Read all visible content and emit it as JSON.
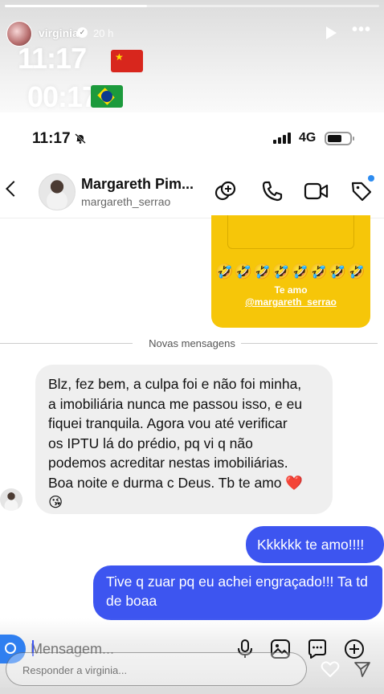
{
  "story": {
    "username": "virginia",
    "time_ago": "20 h",
    "times": [
      "11:17",
      "00:17"
    ],
    "flags": [
      "china-flag",
      "brazil-flag"
    ],
    "progress": 0.38,
    "reply_placeholder": "Responder a virginia..."
  },
  "status_bar": {
    "time": "11:17",
    "network": "4G"
  },
  "chat_header": {
    "name": "Margareth Pim...",
    "username": "margareth_serrao"
  },
  "story_reply": {
    "emojis": "🤣🤣🤣🤣🤣🤣🤣🤣",
    "text": "Te amo",
    "mention": "@margareth_serrao"
  },
  "separator": "Novas mensagens",
  "messages": {
    "incoming": "Blz, fez bem, a culpa foi e não foi minha,\na imobiliária nunca me passou isso, e eu\nfiquei tranquila. Agora vou até verificar\nos IPTU lá do prédio, pq vi q não\npodemos acreditar nestas imobiliárias.\nBoa noite e durma c Deus. Tb te amo ❤️\n😘",
    "outgoing_1": "Kkkkkk te amo!!!!",
    "outgoing_2": "Tive q zuar pq eu achei engraçado!!! Ta td de boaa"
  },
  "composer": {
    "placeholder": "Mensagem..."
  },
  "colors": {
    "outgoing_bubble": "#3d55f0",
    "story_card": "#f6c609",
    "camera_button": "#2f7ff0"
  }
}
